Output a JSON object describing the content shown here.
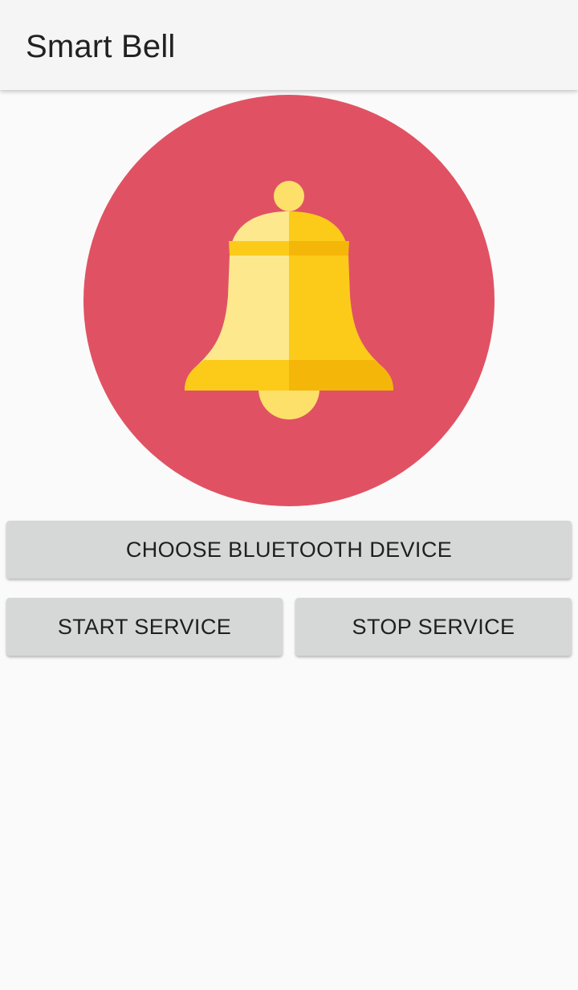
{
  "app_bar": {
    "title": "Smart Bell"
  },
  "hero": {
    "icon": "bell-icon",
    "circle_color": "#e05263",
    "bell_colors": {
      "light": "#fde88e",
      "mid": "#fccb1a",
      "dark": "#f4b609"
    }
  },
  "actions": {
    "choose_device_label": "CHOOSE BLUETOOTH DEVICE",
    "start_service_label": "START SERVICE",
    "stop_service_label": "STOP SERVICE"
  }
}
